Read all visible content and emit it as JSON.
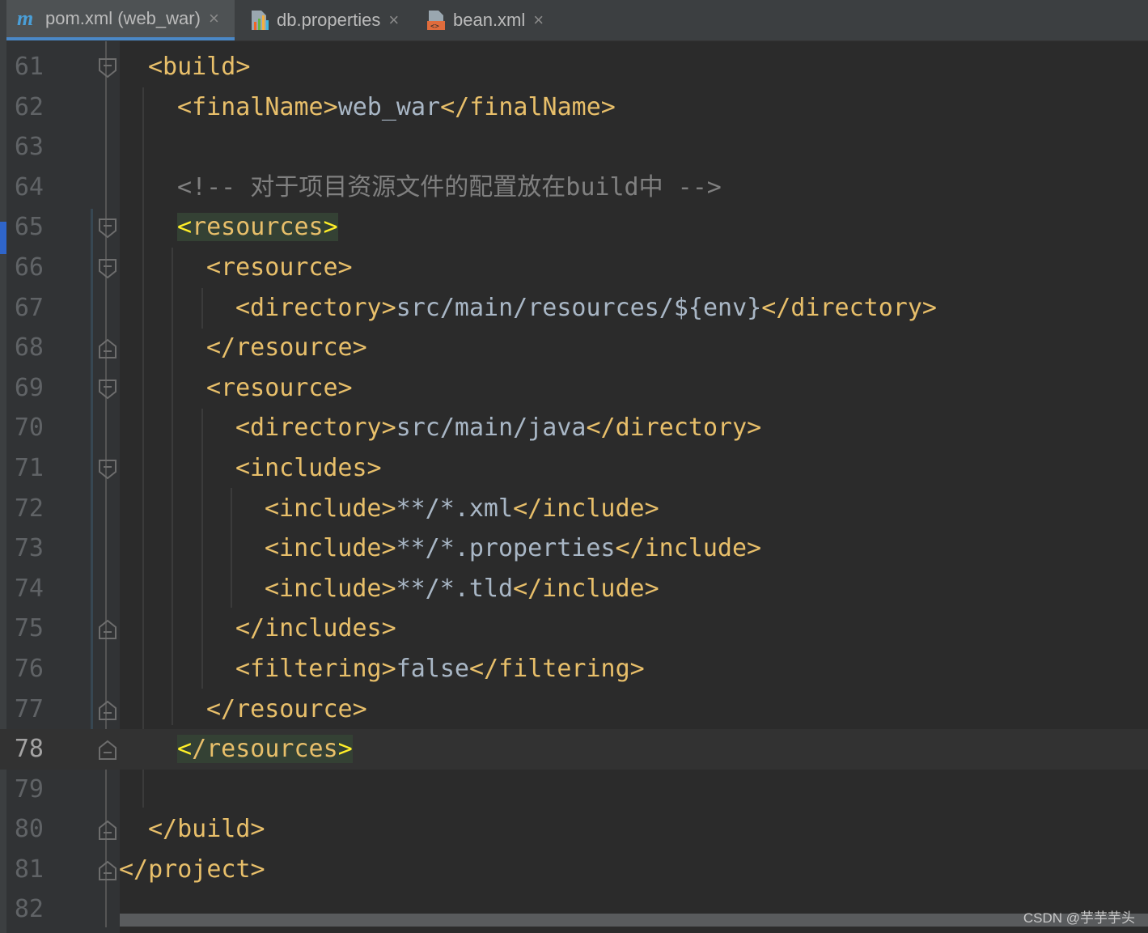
{
  "tabs": [
    {
      "label": "pom.xml (web_war)",
      "icon": "maven-icon",
      "active": true
    },
    {
      "label": "db.properties",
      "icon": "properties-file-icon",
      "active": false
    },
    {
      "label": "bean.xml",
      "icon": "xml-file-icon",
      "active": false
    }
  ],
  "close_glyph": "×",
  "lines": [
    {
      "num": "61",
      "tokens": [
        {
          "t": "tag",
          "v": "<build>"
        }
      ]
    },
    {
      "num": "62",
      "tokens": [
        {
          "t": "tag",
          "v": "<finalName>"
        },
        {
          "t": "text",
          "v": "web_war"
        },
        {
          "t": "tag",
          "v": "</finalName>"
        }
      ]
    },
    {
      "num": "63",
      "tokens": []
    },
    {
      "num": "64",
      "tokens": [
        {
          "t": "comment",
          "v": "<!-- 对于项目资源文件的配置放在build中 -->"
        }
      ]
    },
    {
      "num": "65",
      "tokens": [
        {
          "t": "tag-hl",
          "v": "<resources>"
        }
      ]
    },
    {
      "num": "66",
      "tokens": [
        {
          "t": "tag",
          "v": "<resource>"
        }
      ]
    },
    {
      "num": "67",
      "tokens": [
        {
          "t": "tag",
          "v": "<directory>"
        },
        {
          "t": "text",
          "v": "src/main/resources/${env}"
        },
        {
          "t": "tag",
          "v": "</directory>"
        }
      ]
    },
    {
      "num": "68",
      "tokens": [
        {
          "t": "tag",
          "v": "</resource>"
        }
      ]
    },
    {
      "num": "69",
      "tokens": [
        {
          "t": "tag",
          "v": "<resource>"
        }
      ]
    },
    {
      "num": "70",
      "tokens": [
        {
          "t": "tag",
          "v": "<directory>"
        },
        {
          "t": "text",
          "v": "src/main/java"
        },
        {
          "t": "tag",
          "v": "</directory>"
        }
      ]
    },
    {
      "num": "71",
      "tokens": [
        {
          "t": "tag",
          "v": "<includes>"
        }
      ]
    },
    {
      "num": "72",
      "tokens": [
        {
          "t": "tag",
          "v": "<include>"
        },
        {
          "t": "text",
          "v": "**/*.xml"
        },
        {
          "t": "tag",
          "v": "</include>"
        }
      ]
    },
    {
      "num": "73",
      "tokens": [
        {
          "t": "tag",
          "v": "<include>"
        },
        {
          "t": "text",
          "v": "**/*.properties"
        },
        {
          "t": "tag",
          "v": "</include>"
        }
      ]
    },
    {
      "num": "74",
      "tokens": [
        {
          "t": "tag",
          "v": "<include>"
        },
        {
          "t": "text",
          "v": "**/*.tld"
        },
        {
          "t": "tag",
          "v": "</include>"
        }
      ]
    },
    {
      "num": "75",
      "tokens": [
        {
          "t": "tag",
          "v": "</includes>"
        }
      ]
    },
    {
      "num": "76",
      "tokens": [
        {
          "t": "tag",
          "v": "<filtering>"
        },
        {
          "t": "text",
          "v": "false"
        },
        {
          "t": "tag",
          "v": "</filtering>"
        }
      ]
    },
    {
      "num": "77",
      "tokens": [
        {
          "t": "tag",
          "v": "</resource>"
        }
      ]
    },
    {
      "num": "78",
      "tokens": [
        {
          "t": "tag-hl-close",
          "v": "</resources>"
        }
      ]
    },
    {
      "num": "79",
      "tokens": []
    },
    {
      "num": "80",
      "tokens": [
        {
          "t": "tag",
          "v": "</build>"
        }
      ]
    },
    {
      "num": "81",
      "tokens": [
        {
          "t": "tag",
          "v": "</project>"
        }
      ]
    },
    {
      "num": "82",
      "tokens": []
    }
  ],
  "current_line": "78",
  "watermark": "CSDN @芋芋芋头",
  "colors": {
    "tag": "#e8bf6a",
    "text": "#a9b7c6",
    "comment": "#808080",
    "background": "#2b2b2b",
    "match_highlight": "#344134"
  }
}
